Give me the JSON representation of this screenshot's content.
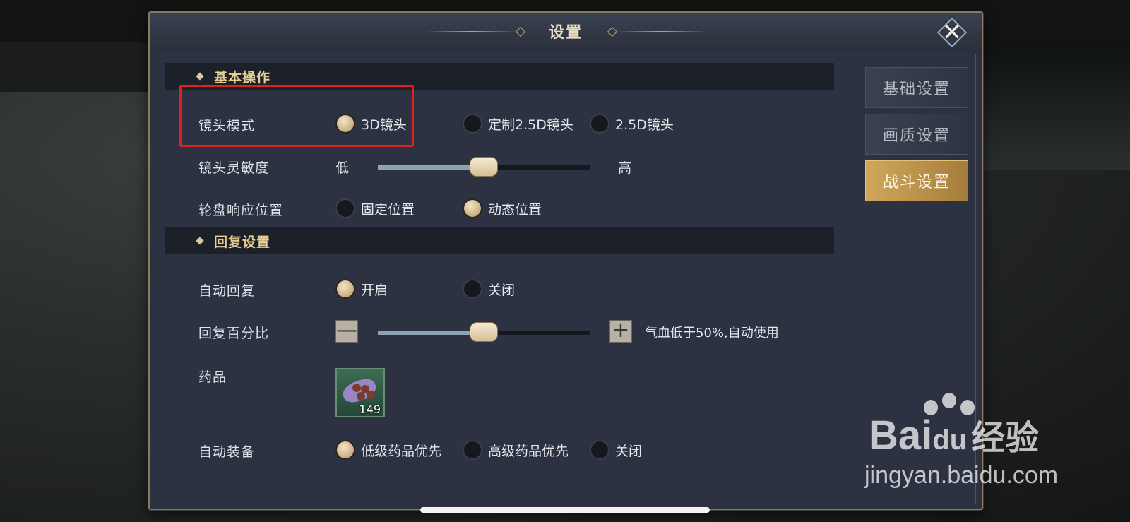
{
  "dialog": {
    "title": "设置",
    "close_icon": "close-icon"
  },
  "tabs": [
    {
      "label": "基础设置",
      "active": false
    },
    {
      "label": "画质设置",
      "active": false
    },
    {
      "label": "战斗设置",
      "active": true
    }
  ],
  "basic": {
    "section_title": "基本操作",
    "camera_mode": {
      "label": "镜头模式",
      "options": [
        "3D镜头",
        "定制2.5D镜头",
        "2.5D镜头"
      ],
      "selected": "3D镜头"
    },
    "camera_sensitivity": {
      "label": "镜头灵敏度",
      "low_label": "低",
      "high_label": "高",
      "value_fraction": 0.5
    },
    "wheel_position": {
      "label": "轮盘响应位置",
      "options": [
        "固定位置",
        "动态位置"
      ],
      "selected": "动态位置"
    }
  },
  "recovery": {
    "section_title": "回复设置",
    "auto_recover": {
      "label": "自动回复",
      "options": [
        "开启",
        "关闭"
      ],
      "selected": "开启"
    },
    "recover_percent": {
      "label": "回复百分比",
      "minus": "—",
      "plus": "+",
      "value_fraction": 0.5,
      "description": "气血低于50%,自动使用"
    },
    "medicine": {
      "label": "药品",
      "item_count": "149",
      "item_icon": "medicine-pouch-icon"
    },
    "auto_equip": {
      "label": "自动装备",
      "options": [
        "低级药品优先",
        "高级药品优先",
        "关闭"
      ],
      "selected": "低级药品优先"
    }
  },
  "watermark": {
    "brand": "Bai",
    "brand_suffix": "du",
    "brand_cn": "经验",
    "url": "jingyan.baidu.com"
  },
  "colors": {
    "accent_gold": "#d0a85a",
    "highlight_red": "#e0201a",
    "panel_bg": "#2b3140"
  }
}
